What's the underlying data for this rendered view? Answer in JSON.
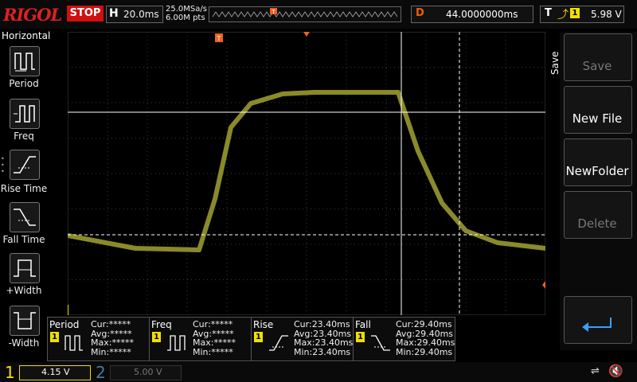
{
  "topbar": {
    "logo": "RIGOL",
    "run_state": "STOP",
    "timebase_label": "H",
    "timebase": "20.0ms",
    "sample_rate": "25.0MSa/s",
    "memory_depth": "6.00M pts",
    "delay_label": "D",
    "delay": "44.0000000ms",
    "trigger_label": "T",
    "trigger_channel": "1",
    "trigger_level": "5.98 V",
    "trigger_edge_icon": "rising-edge-icon"
  },
  "left_menu": {
    "title": "Horizontal",
    "items": [
      {
        "label": "Period",
        "icon": "period-icon"
      },
      {
        "label": "Freq",
        "icon": "freq-icon"
      },
      {
        "label": "Rise Time",
        "icon": "rise-time-icon"
      },
      {
        "label": "Fall Time",
        "icon": "fall-time-icon"
      },
      {
        "label": "+Width",
        "icon": "positive-width-icon"
      },
      {
        "label": "-Width",
        "icon": "negative-width-icon"
      }
    ]
  },
  "right_menu": {
    "title": "Save",
    "items": [
      {
        "label": "Save",
        "enabled": false
      },
      {
        "label": "New File",
        "enabled": true
      },
      {
        "label": "NewFolder",
        "enabled": true
      },
      {
        "label": "Delete",
        "enabled": false
      },
      {
        "label": "",
        "icon": "return-arrow-icon",
        "enabled": true
      }
    ]
  },
  "measurements": [
    {
      "name": "Period",
      "channel": "1",
      "cur": "Cur:*****",
      "avg": "Avg:*****",
      "max": "Max:*****",
      "min": "Min:*****"
    },
    {
      "name": "Freq",
      "channel": "1",
      "cur": "Cur:*****",
      "avg": "Avg:*****",
      "max": "Max:*****",
      "min": "Min:*****"
    },
    {
      "name": "Rise",
      "channel": "1",
      "cur": "Cur:23.40ms",
      "avg": "Avg:23.40ms",
      "max": "Max:23.40ms",
      "min": "Min:23.40ms"
    },
    {
      "name": "Fall",
      "channel": "1",
      "cur": "Cur:29.40ms",
      "avg": "Avg:29.40ms",
      "max": "Max:29.40ms",
      "min": "Min:29.40ms"
    }
  ],
  "channels": [
    {
      "num": "1",
      "scale": "4.15 V",
      "color": "#f0e000",
      "active": true
    },
    {
      "num": "2",
      "scale": "5.00 V",
      "color": "#4a7a9a",
      "active": false
    }
  ],
  "colors": {
    "waveform": "#8a8a2a",
    "stop": "#d01010",
    "trigger_marker": "#f06020"
  }
}
